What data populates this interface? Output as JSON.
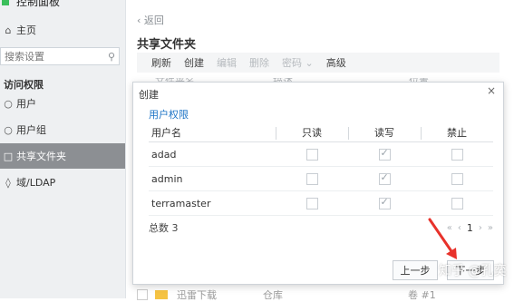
{
  "sidebar": {
    "top_title": "控制面板",
    "home": "主页",
    "search_placeholder": "搜索设置",
    "section": "访问权限",
    "items": [
      {
        "label": "用户"
      },
      {
        "label": "用户组"
      },
      {
        "label": "共享文件夹",
        "active": true
      },
      {
        "label": "域/LDAP"
      }
    ]
  },
  "main": {
    "back": "返回",
    "title": "共享文件夹",
    "toolbar": [
      "刷新",
      "创建",
      "编辑",
      "删除",
      "密码",
      "高级"
    ],
    "bg_headers": [
      "文件夹名",
      "描述",
      "位置"
    ],
    "bottom_row": {
      "name": "迅雷下载",
      "desc": "仓库",
      "volume": "卷 #1"
    }
  },
  "dialog": {
    "title": "创建",
    "close": "×",
    "section": "用户权限",
    "columns": {
      "name": "用户名",
      "readonly": "只读",
      "readwrite": "读写",
      "deny": "禁止"
    },
    "rows": [
      {
        "name": "adad"
      },
      {
        "name": "admin"
      },
      {
        "name": "terramaster"
      }
    ],
    "total": "总数 3",
    "page": "1",
    "prev_button": "上一步",
    "next_button": "下一步"
  },
  "watermark": "知乎 @孔奕",
  "colors": {
    "accent": "#1d74c6",
    "arrow": "#e8322b",
    "sidebar_active": "#8c8f93"
  }
}
